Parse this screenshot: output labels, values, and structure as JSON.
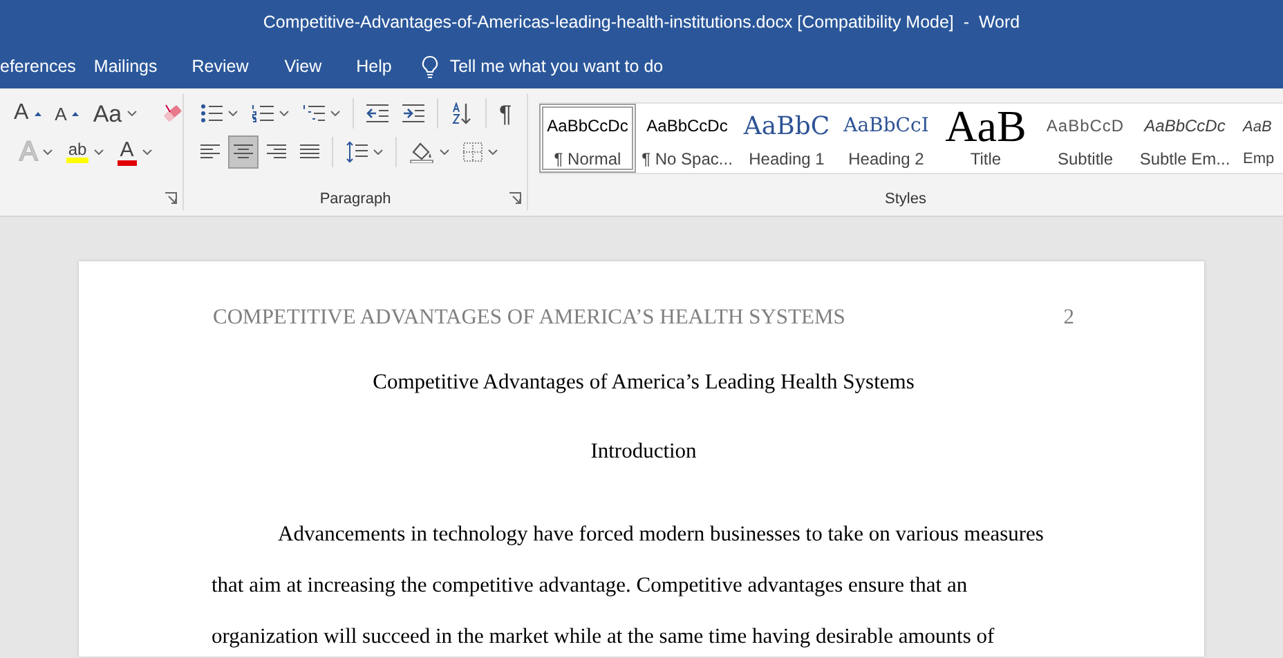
{
  "window": {
    "title": "Competitive-Advantages-of-Americas-leading-health-institutions.docx [Compatibility Mode]  -  Word"
  },
  "tabs": [
    {
      "label": "eferences",
      "selected": false
    },
    {
      "label": "Mailings",
      "selected": false
    },
    {
      "label": "Review",
      "selected": false
    },
    {
      "label": "View",
      "selected": false
    },
    {
      "label": "Help",
      "selected": false
    }
  ],
  "tell_me": {
    "placeholder": "Tell me what you want to do"
  },
  "font_group": {
    "row_1": [
      {
        "kind": "grow",
        "glyph": "A",
        "dropdown": false
      },
      {
        "kind": "shrink",
        "glyph": "A",
        "dropdown": false
      },
      {
        "kind": "case",
        "glyph": "Aa",
        "dropdown": true
      },
      {
        "kind": "clear",
        "dropdown": false
      }
    ],
    "row_2": [
      {
        "kind": "effects",
        "glyph": "A",
        "dropdown": true
      },
      {
        "kind": "highlight",
        "glyph": "ab",
        "dropdown": true
      },
      {
        "kind": "color",
        "glyph": "A",
        "dropdown": true
      }
    ]
  },
  "paragraph_group": {
    "label": "Paragraph",
    "row_1": [
      {
        "kind": "bullets",
        "dropdown": true,
        "selected": false
      },
      {
        "kind": "numbering",
        "dropdown": true,
        "selected": false
      },
      {
        "kind": "multilevel",
        "dropdown": true,
        "selected": false
      },
      {
        "kind": "outdent",
        "dropdown": false,
        "selected": false
      },
      {
        "kind": "indent",
        "dropdown": false,
        "selected": false
      },
      {
        "kind": "sort",
        "dropdown": false,
        "selected": false
      },
      {
        "kind": "pilcrow",
        "glyph": "¶",
        "dropdown": false,
        "selected": false
      }
    ],
    "row_2": [
      {
        "kind": "align-left",
        "dropdown": false,
        "selected": false
      },
      {
        "kind": "align-center",
        "dropdown": false,
        "selected": true
      },
      {
        "kind": "align-right",
        "dropdown": false,
        "selected": false
      },
      {
        "kind": "justify",
        "dropdown": false,
        "selected": false
      },
      {
        "kind": "spacing",
        "dropdown": true,
        "selected": false
      },
      {
        "kind": "shading",
        "dropdown": true,
        "selected": false
      },
      {
        "kind": "borders",
        "dropdown": true,
        "selected": false
      }
    ]
  },
  "styles_group": {
    "label": "Styles",
    "items": [
      {
        "sample": "AaBbCcDc",
        "name": "¶ Normal",
        "kind": "normal",
        "selected": true
      },
      {
        "sample": "AaBbCcDc",
        "name": "¶ No Spac...",
        "kind": "normal",
        "selected": false
      },
      {
        "sample": "AaBbC",
        "name": "Heading 1",
        "kind": "heading1",
        "selected": false
      },
      {
        "sample": "AaBbCcI",
        "name": "Heading 2",
        "kind": "heading2",
        "selected": false
      },
      {
        "sample": "AaB",
        "name": "Title",
        "kind": "title",
        "selected": false
      },
      {
        "sample": "AaBbCcD",
        "name": "Subtitle",
        "kind": "subtitle",
        "selected": false
      },
      {
        "sample": "AaBbCcDc",
        "name": "Subtle Em...",
        "kind": "emphasis",
        "selected": false
      },
      {
        "sample": "AaB",
        "name": "Emp",
        "kind": "emphasis",
        "selected": false
      }
    ]
  },
  "document": {
    "header": "COMPETITIVE ADVANTAGES OF AMERICA’S HEALTH SYSTEMS",
    "page_number": "2",
    "title": "Competitive Advantages of America’s Leading Health Systems",
    "heading": "Introduction",
    "paragraph_lines": [
      "Advancements in technology have forced modern businesses to take on various measures",
      "that aim at increasing the competitive advantage.  Competitive advantages ensure that an",
      "organization will succeed in the market while at the same time having desirable amounts of"
    ]
  }
}
